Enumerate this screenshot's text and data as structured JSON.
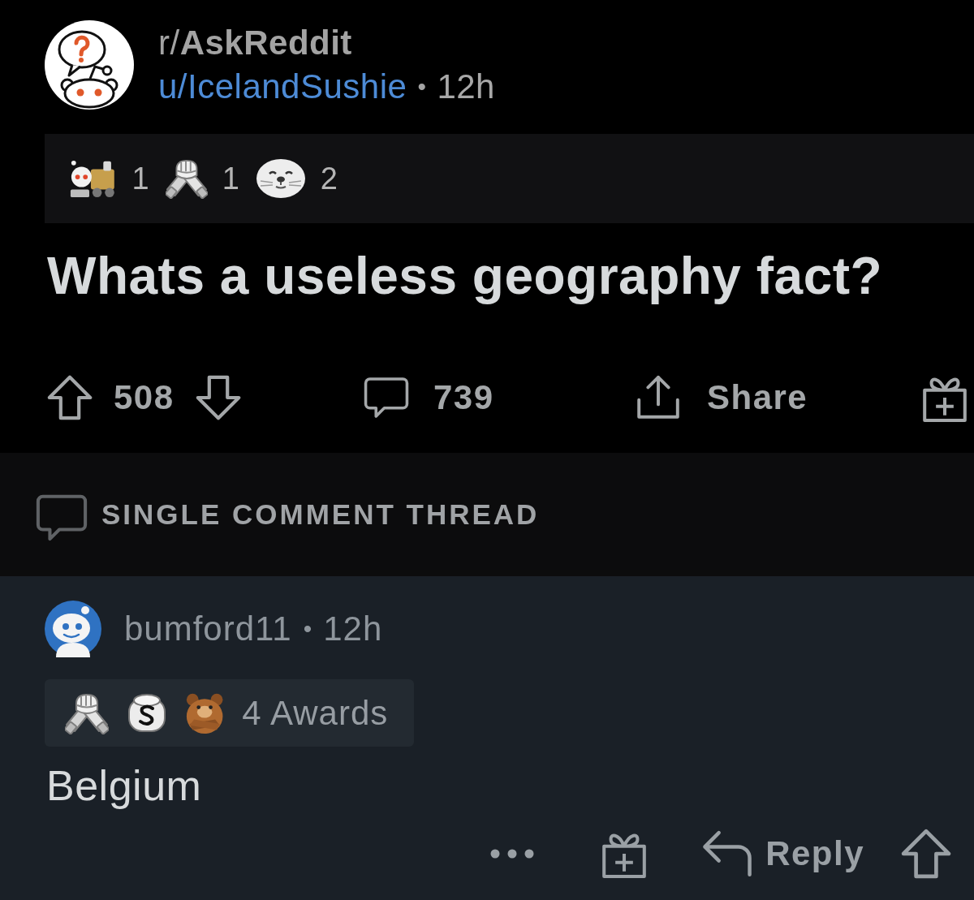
{
  "post": {
    "subreddit": "r/**AskReddit**",
    "author": "u/IcelandSushie",
    "separator": "•",
    "time": "12h",
    "awards": [
      {
        "kind": "robot-train",
        "count": "1"
      },
      {
        "kind": "handshake",
        "count": "1"
      },
      {
        "kind": "seal",
        "count": "2"
      }
    ],
    "title": "Whats a useless geography fact?",
    "actions": {
      "score": "508",
      "comments": "739",
      "share": "Share"
    }
  },
  "thread_banner": {
    "label": "SINGLE COMMENT THREAD"
  },
  "comment": {
    "author": "bumford11",
    "separator": "•",
    "time": "12h",
    "awards": [
      {
        "kind": "handshake"
      },
      {
        "kind": "coin"
      },
      {
        "kind": "bear"
      }
    ],
    "awards_label": "4 Awards",
    "body": "Belgium",
    "reply": "Reply"
  }
}
